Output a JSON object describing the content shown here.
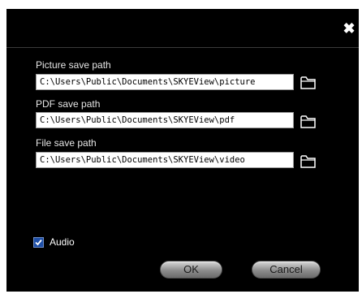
{
  "dialog": {
    "close_icon": "close-icon",
    "close_glyph": "✖"
  },
  "paths": {
    "picture_label": "Picture save path",
    "picture_value": "C:\\Users\\Public\\Documents\\SKYEView\\picture",
    "pdf_label": "PDF save path",
    "pdf_value": "C:\\Users\\Public\\Documents\\SKYEView\\pdf",
    "file_label": "File save path",
    "file_value": "C:\\Users\\Public\\Documents\\SKYEView\\video"
  },
  "audio": {
    "label": "Audio",
    "checked": true
  },
  "buttons": {
    "ok_label": "OK",
    "cancel_label": "Cancel"
  },
  "colors": {
    "background": "#000000",
    "text": "#ffffff",
    "checkbox": "#1e4fa8"
  }
}
